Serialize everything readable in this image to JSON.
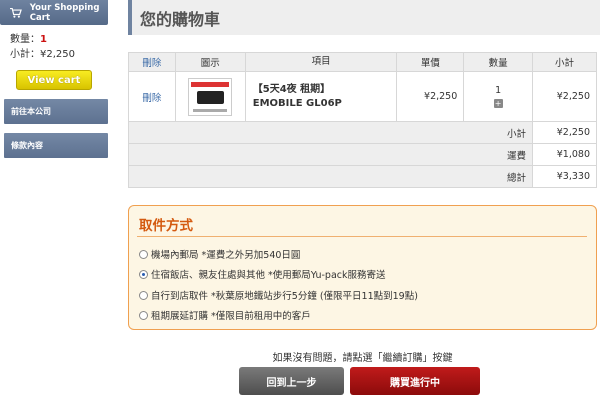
{
  "sidebar": {
    "cart_title": "Your Shopping Cart",
    "qty_label": "數量：",
    "qty_value": "1",
    "subtotal_label": "小計：",
    "subtotal_value": "¥2,250",
    "view_cart": "View cart",
    "links": [
      "前往本公司",
      "條款內容"
    ]
  },
  "main": {
    "title": "您的購物車",
    "table": {
      "headers": [
        "刪除",
        "圖示",
        "項目",
        "單價",
        "數量",
        "小計"
      ],
      "row": {
        "delete": "刪除",
        "item_line1": "【5天4夜 租期】",
        "item_line2": "EMOBILE GL06P",
        "price": "¥2,250",
        "qty": "1",
        "subtotal": "¥2,250"
      },
      "summary": [
        {
          "label": "小計",
          "value": "¥2,250"
        },
        {
          "label": "運費",
          "value": "¥1,080"
        },
        {
          "label": "總計",
          "value": "¥3,330"
        }
      ]
    },
    "delivery": {
      "title": "取件方式",
      "options": [
        {
          "label": "機場內郵局 *運費之外另加540日圓",
          "checked": false
        },
        {
          "label": "住宿飯店、親友住處與其他 *使用郵局Yu-pack服務寄送",
          "checked": true
        },
        {
          "label": "自行到店取件 *秋葉原地鐵站步行5分鐘 (僅限平日11點到19點)",
          "checked": false
        },
        {
          "label": "租期展延訂購 *僅限目前租用中的客戶",
          "checked": false
        }
      ]
    },
    "notice": "如果沒有問題，請點選「繼續訂購」按鍵",
    "back_button": "回到上一步",
    "next_button": "購買進行中"
  },
  "colors": {
    "sidebar_accent": "#6f83a0",
    "view_cart_yellow": "#e8d400",
    "method_orange": "#d45a10",
    "next_red": "#a81414"
  }
}
